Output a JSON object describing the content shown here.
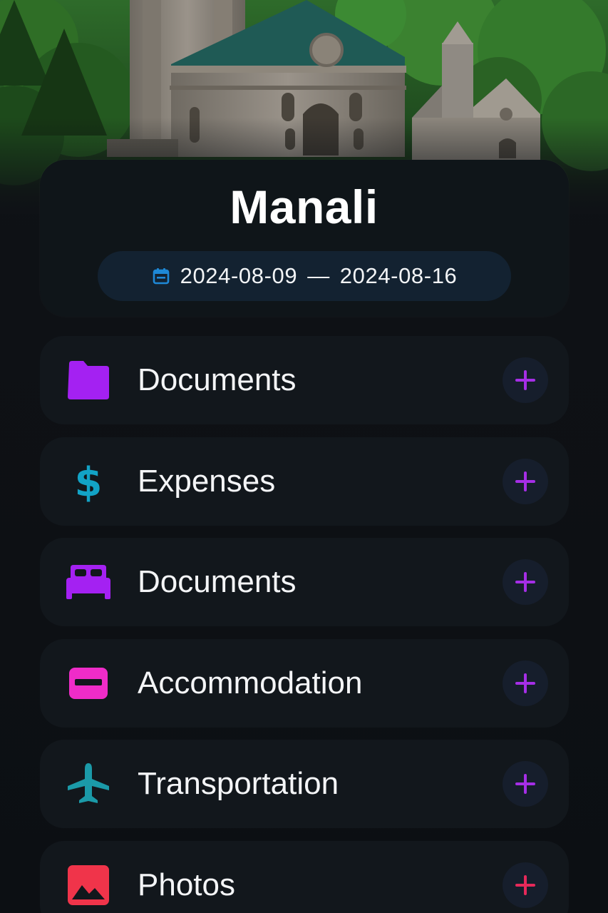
{
  "trip": {
    "title": "Manali",
    "start_date": "2024-08-09",
    "separator": "—",
    "end_date": "2024-08-16",
    "calendar_icon": "calendar-icon",
    "calendar_color": "#1e88d6"
  },
  "categories": [
    {
      "label": "Documents",
      "icon": "folder-icon",
      "color": "#a421f2",
      "add_color": "#a52ee6"
    },
    {
      "label": "Expenses",
      "icon": "dollar-icon",
      "color": "#12a3c6",
      "add_color": "#a52ee6"
    },
    {
      "label": "Documents",
      "icon": "bed-icon",
      "color": "#a421f2",
      "add_color": "#a52ee6"
    },
    {
      "label": "Accommodation",
      "icon": "card-icon",
      "color": "#ef2cc8",
      "add_color": "#a52ee6"
    },
    {
      "label": "Transportation",
      "icon": "airplane-icon",
      "color": "#1b9aa8",
      "add_color": "#a52ee6"
    },
    {
      "label": "Photos",
      "icon": "image-icon",
      "color": "#f0344a",
      "add_color": "#e6295a"
    }
  ],
  "add_icon": "plus-icon"
}
